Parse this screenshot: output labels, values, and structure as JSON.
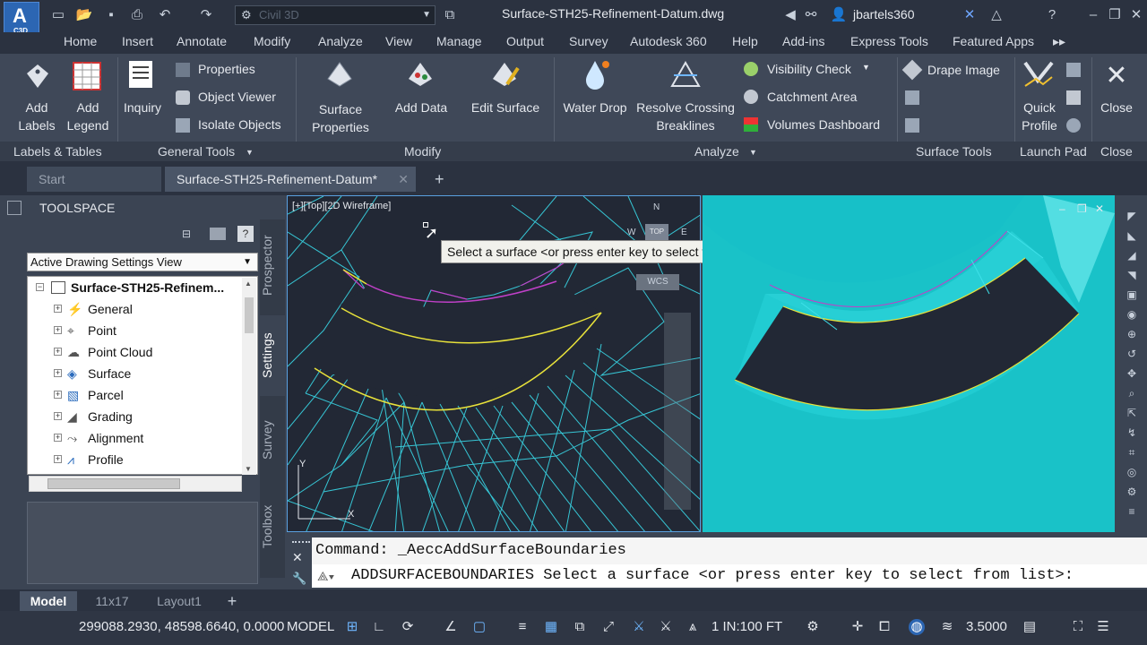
{
  "app": {
    "logo_letter": "A",
    "logo_sub": "C3D",
    "workspace_placeholder": "Civil 3D",
    "document_title": "Surface-STH25-Refinement-Datum.dwg",
    "user": "jbartels360"
  },
  "menu_tabs": [
    "Home",
    "Insert",
    "Annotate",
    "Modify",
    "Analyze",
    "View",
    "Manage",
    "Output",
    "Survey",
    "Autodesk 360",
    "Help",
    "Add-ins",
    "Express Tools",
    "Featured Apps"
  ],
  "ribbon": {
    "add_labels": "Add\nLabels",
    "add_legend": "Add\nLegend",
    "inquiry": "Inquiry",
    "properties": "Properties",
    "object_viewer": "Object Viewer",
    "isolate_objects": "Isolate Objects",
    "surface_properties": "Surface\nProperties",
    "add_data": "Add Data",
    "edit_surface": "Edit Surface",
    "water_drop": "Water Drop",
    "resolve_crossing": "Resolve Crossing\nBreaklines",
    "visibility_check": "Visibility Check",
    "catchment_area": "Catchment Area",
    "volumes_dashboard": "Volumes Dashboard",
    "drape_image": "Drape Image",
    "quick_profile": "Quick\nProfile",
    "close": "Close"
  },
  "panels": [
    "Labels & Tables",
    "General Tools",
    "Modify",
    "Analyze",
    "Surface Tools",
    "Launch Pad",
    "Close"
  ],
  "file_tabs": {
    "start": "Start",
    "doc": "Surface-STH25-Refinement-Datum*"
  },
  "toolspace": {
    "title": "TOOLSPACE",
    "view": "Active Drawing Settings View",
    "root": "Surface-STH25-Refinem...",
    "items": [
      "General",
      "Point",
      "Point Cloud",
      "Surface",
      "Parcel",
      "Grading",
      "Alignment",
      "Profile"
    ],
    "side_tabs": [
      "Prospector",
      "Settings",
      "Survey",
      "Toolbox"
    ]
  },
  "viewport": {
    "label": "[+][Top][2D Wireframe]",
    "tooltip": "Select a surface <or press enter key to select from list>:",
    "compass": {
      "n": "N",
      "w": "W",
      "e": "E",
      "top": "TOP",
      "wcs": "WCS"
    },
    "ucs": {
      "x": "X",
      "y": "Y"
    }
  },
  "command": {
    "history": "Command:  _AeccAddSurfaceBoundaries",
    "input": "ADDSURFACEBOUNDARIES Select a surface <or press enter key to select from list>:"
  },
  "layout_tabs": [
    "Model",
    "11x17",
    "Layout1"
  ],
  "status": {
    "coords": "299088.2930, 48598.6640, 0.0000",
    "mode": "MODEL",
    "scale": "1 IN:100 FT",
    "value": "3.5000"
  },
  "colors": {
    "accent": "#2c66b3",
    "surface": "#17c0c8",
    "tin": "#39d7e6",
    "boundary": "#e8e23a",
    "mesh_magenta": "#c040c8"
  }
}
